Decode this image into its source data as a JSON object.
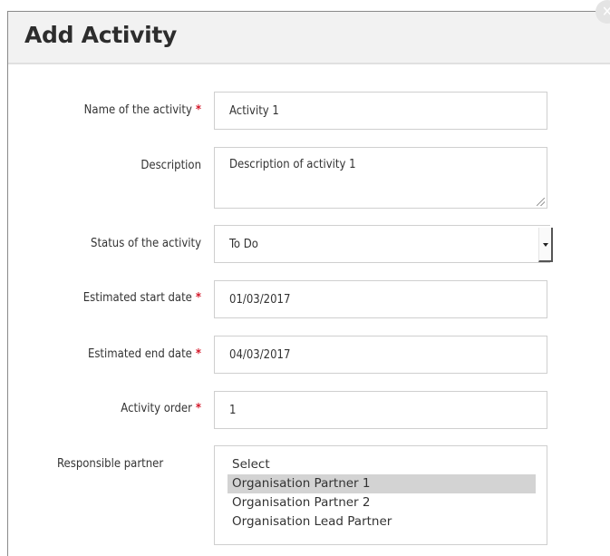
{
  "dialog": {
    "title": "Add Activity",
    "close_glyph": "✕"
  },
  "form": {
    "name": {
      "label": "Name of the activity",
      "required_mark": "*",
      "value": "Activity 1"
    },
    "description": {
      "label": "Description",
      "value": "Description of activity 1"
    },
    "status": {
      "label": "Status of the activity",
      "value": "To Do"
    },
    "start_date": {
      "label": "Estimated start date",
      "required_mark": "*",
      "value": "01/03/2017"
    },
    "end_date": {
      "label": "Estimated end date",
      "required_mark": "*",
      "value": "04/03/2017"
    },
    "order": {
      "label": "Activity order",
      "required_mark": "*",
      "value": "1"
    },
    "partner": {
      "label": "Responsible partner",
      "options": [
        "Select",
        "Organisation Partner 1",
        "Organisation Partner 2",
        "Organisation Lead Partner"
      ],
      "selected_option": "Organisation Partner 1"
    }
  },
  "colors": {
    "required": "#d4182a",
    "header_bg": "#f2f2f2",
    "selected_option_bg": "#d3d3d3"
  }
}
